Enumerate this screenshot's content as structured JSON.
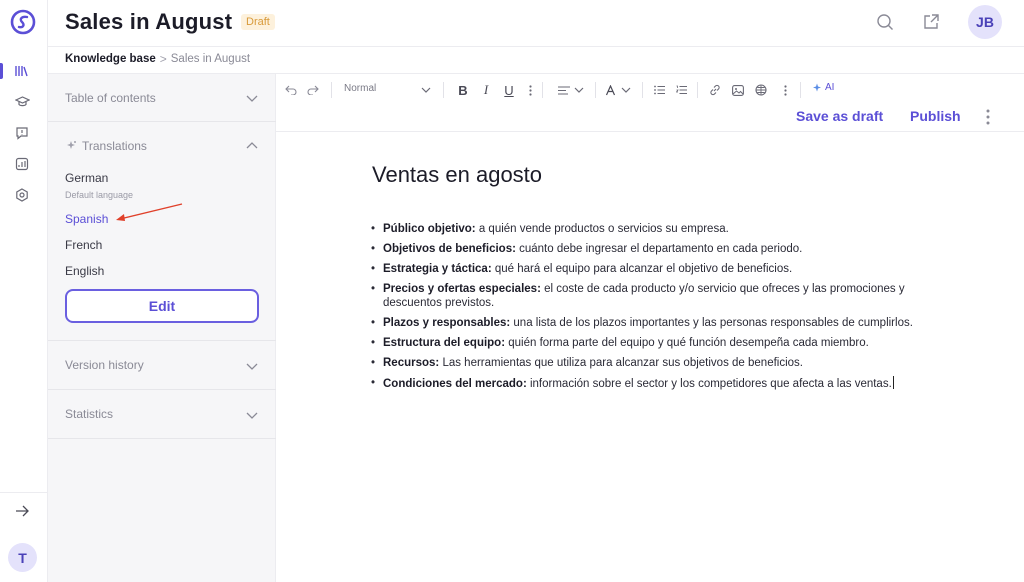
{
  "app": {
    "title": "Sales in August",
    "status_badge": "Draft",
    "user_initials": "JB",
    "rail_user_initial": "T"
  },
  "rail": {
    "items": [
      {
        "icon": "library-icon",
        "active": true
      },
      {
        "icon": "graduation-cap-icon",
        "active": false
      },
      {
        "icon": "feedback-icon",
        "active": false
      },
      {
        "icon": "analytics-icon",
        "active": false
      },
      {
        "icon": "settings-icon",
        "active": false
      }
    ],
    "expand_icon": "arrow-right-icon"
  },
  "header": {
    "icons": [
      "search-icon",
      "share-icon"
    ]
  },
  "breadcrumb": {
    "root": "Knowledge base",
    "separator": ">",
    "current": "Sales in August"
  },
  "panel": {
    "toc_label": "Table of contents",
    "translations_label": "Translations",
    "languages": [
      {
        "name": "German",
        "sub": "Default language",
        "active": false
      },
      {
        "name": "Spanish",
        "sub": "",
        "active": true
      },
      {
        "name": "French",
        "sub": "",
        "active": false
      },
      {
        "name": "English",
        "sub": "",
        "active": false
      }
    ],
    "edit_label": "Edit",
    "version_history_label": "Version history",
    "statistics_label": "Statistics"
  },
  "toolbar": {
    "text_style": "Normal",
    "ai_label": "AI",
    "save_draft_label": "Save as draft",
    "publish_label": "Publish"
  },
  "document": {
    "title": "Ventas en agosto",
    "items": [
      {
        "term": "Público objetivo:",
        "text": " a quién vende productos o servicios su empresa."
      },
      {
        "term": "Objetivos de beneficios:",
        "text": " cuánto debe ingresar el departamento en cada periodo."
      },
      {
        "term": "Estrategia y táctica:",
        "text": " qué hará el equipo para alcanzar el objetivo de beneficios."
      },
      {
        "term": "Precios y ofertas especiales:",
        "text": " el coste de cada producto y/o servicio que ofreces y las promociones y descuentos previstos."
      },
      {
        "term": "Plazos y responsables:",
        "text": " una lista de los plazos importantes y las personas responsables de cumplirlos."
      },
      {
        "term": "Estructura del equipo:",
        "text": " quién forma parte del equipo y qué función desempeña cada miembro."
      },
      {
        "term": "Recursos:",
        "text": " Las herramientas que utiliza para alcanzar sus objetivos de beneficios."
      },
      {
        "term": "Condiciones del mercado:",
        "text": " información sobre el sector y los competidores que afecta a las ventas."
      }
    ]
  },
  "colors": {
    "accent": "#5b4fd6",
    "annotation_arrow": "#e0402a",
    "badge_text": "#d89a3a",
    "badge_bg": "#fdf1dc"
  }
}
